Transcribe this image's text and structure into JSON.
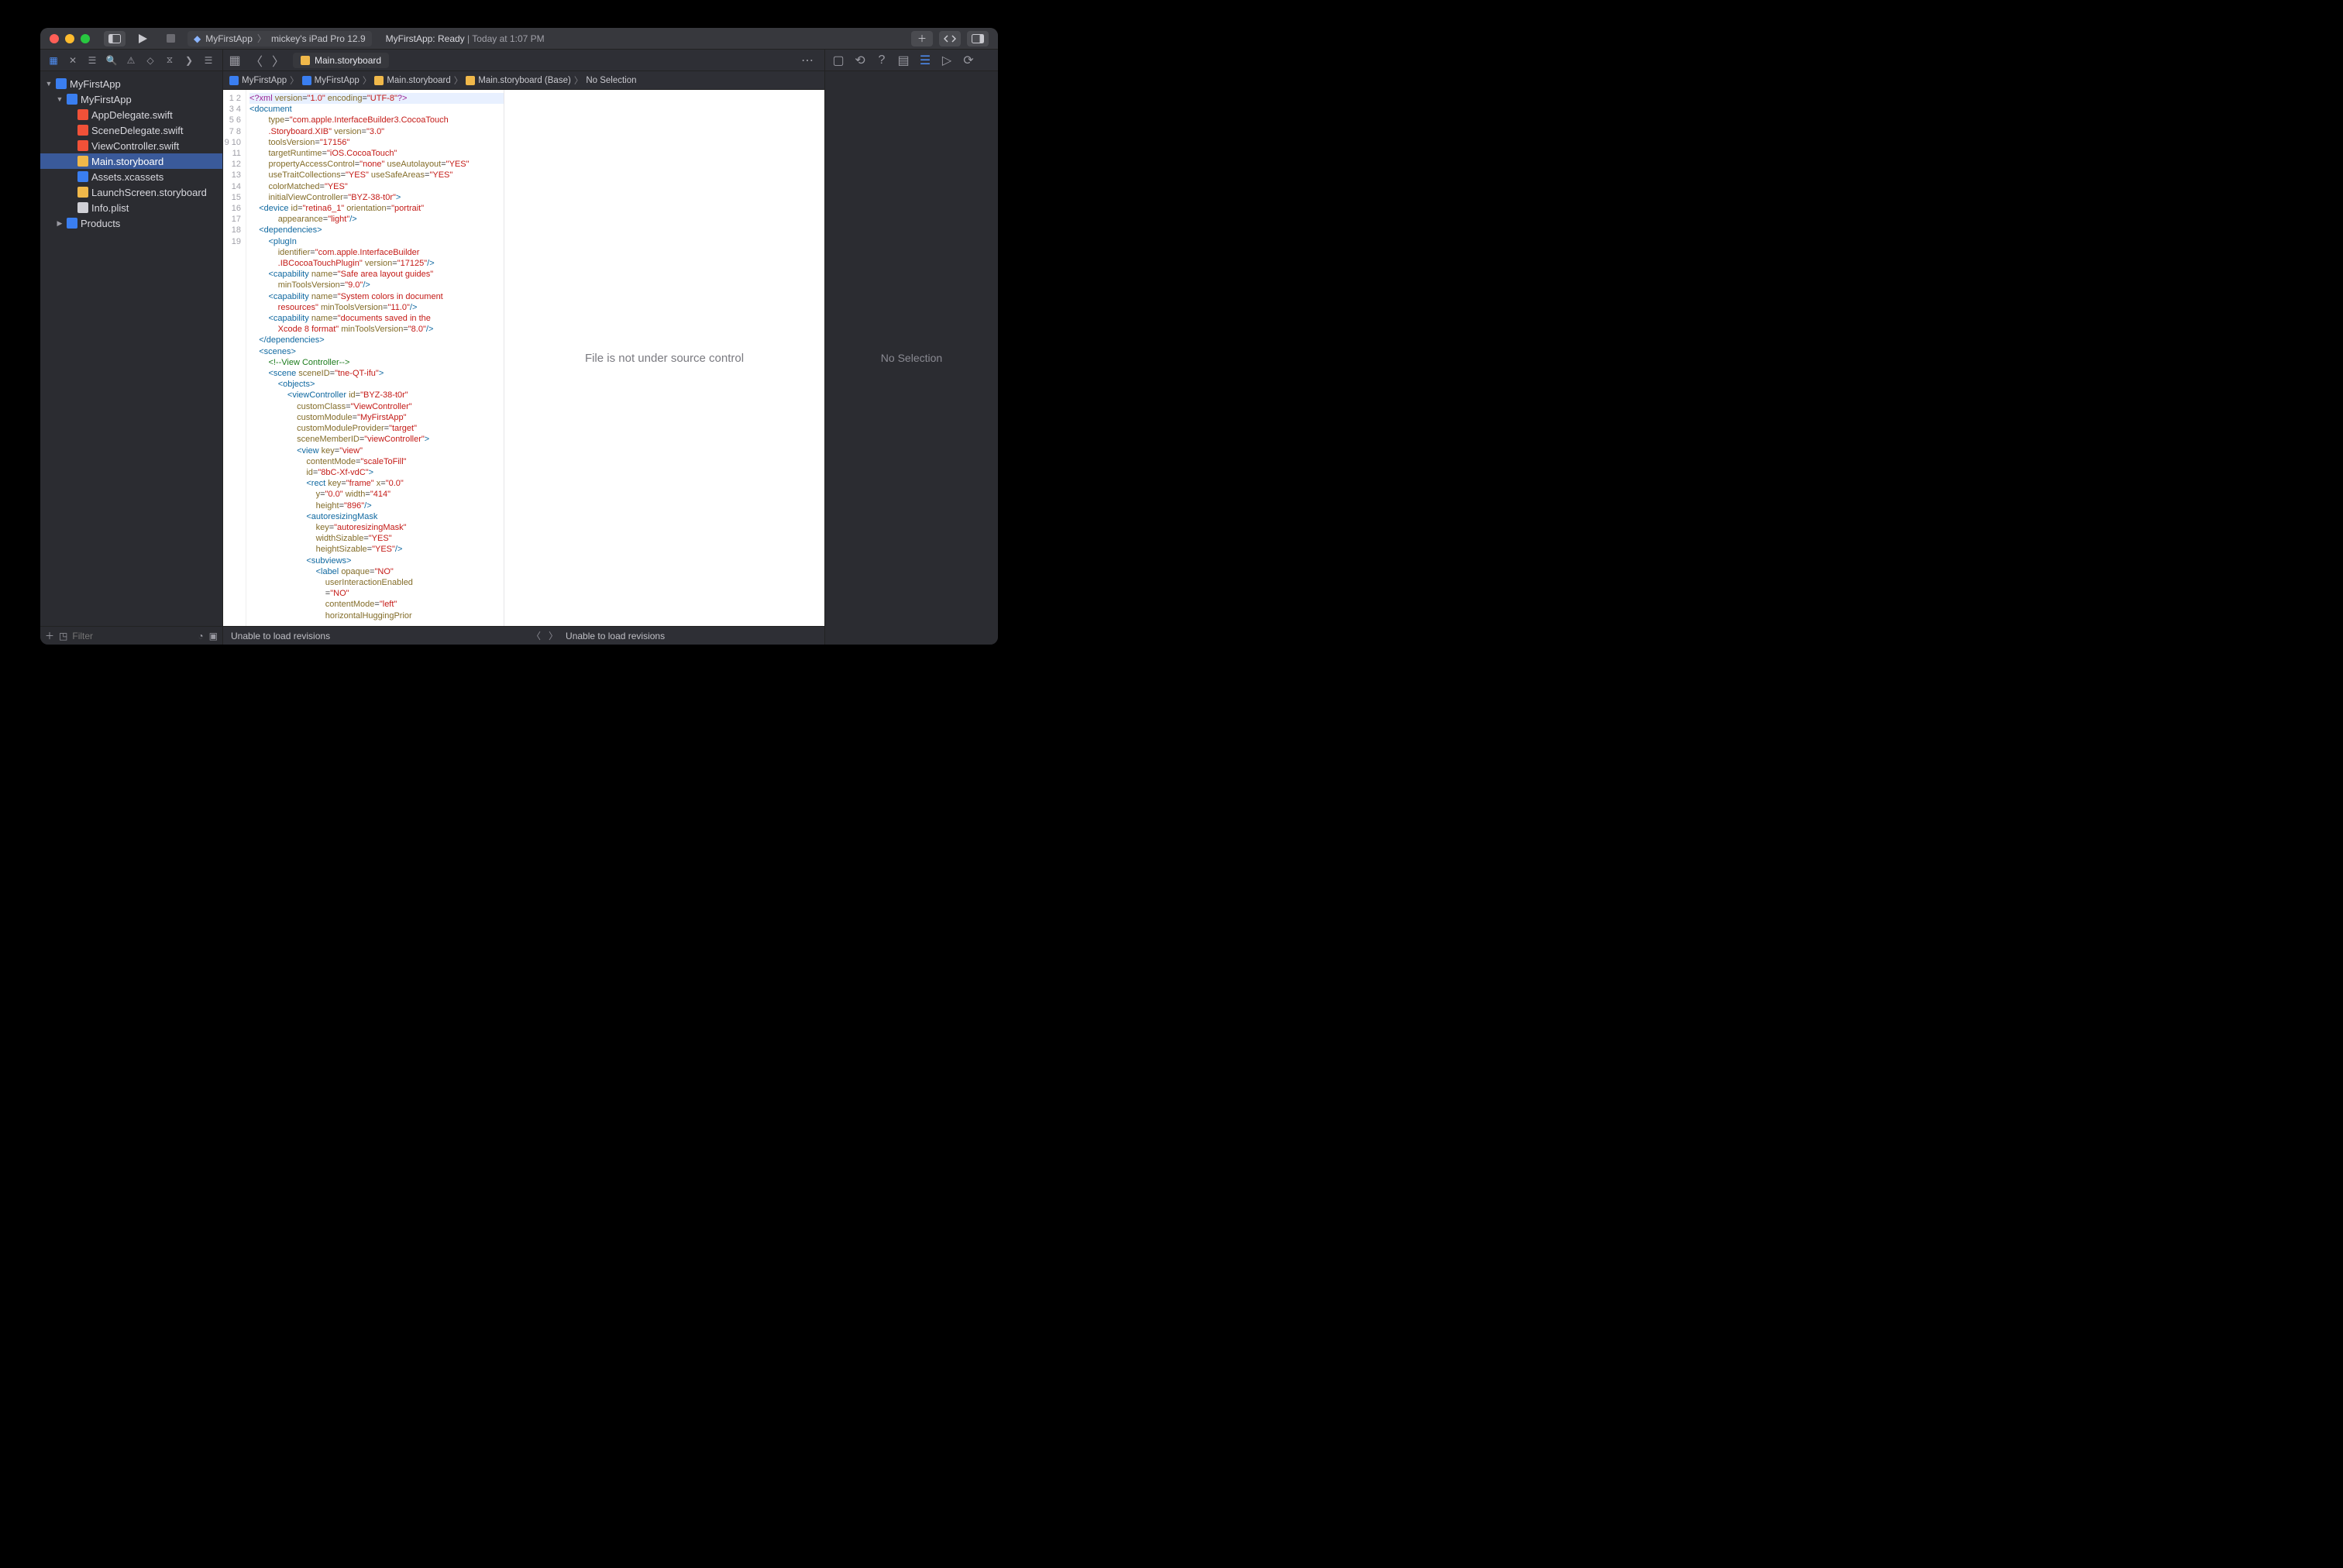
{
  "titlebar": {
    "scheme_app": "MyFirstApp",
    "scheme_device": "mickey's iPad Pro 12.9",
    "status_prefix": "MyFirstApp:",
    "status_state": "Ready",
    "status_time": "Today at 1:07 PM"
  },
  "tabs": {
    "current": "Main.storyboard"
  },
  "jumpbar": {
    "project": "MyFirstApp",
    "group": "MyFirstApp",
    "file": "Main.storyboard",
    "base": "Main.storyboard (Base)",
    "selection": "No Selection"
  },
  "navigator": {
    "root": "MyFirstApp",
    "group": "MyFirstApp",
    "files": [
      {
        "name": "AppDelegate.swift",
        "kind": "swift"
      },
      {
        "name": "SceneDelegate.swift",
        "kind": "swift"
      },
      {
        "name": "ViewController.swift",
        "kind": "swift"
      },
      {
        "name": "Main.storyboard",
        "kind": "sb",
        "selected": true
      },
      {
        "name": "Assets.xcassets",
        "kind": "assets"
      },
      {
        "name": "LaunchScreen.storyboard",
        "kind": "sb"
      },
      {
        "name": "Info.plist",
        "kind": "plist"
      }
    ],
    "products": "Products",
    "filter_placeholder": "Filter"
  },
  "review": {
    "message": "File is not under source control"
  },
  "inspector": {
    "message": "No Selection"
  },
  "bottom": {
    "left": "Unable to load revisions",
    "right": "Unable to load revisions"
  },
  "code": {
    "lines": [
      1,
      2,
      3,
      4,
      5,
      6,
      7,
      8,
      9,
      10,
      11,
      12,
      13,
      14,
      15,
      16,
      17,
      18,
      19
    ]
  }
}
